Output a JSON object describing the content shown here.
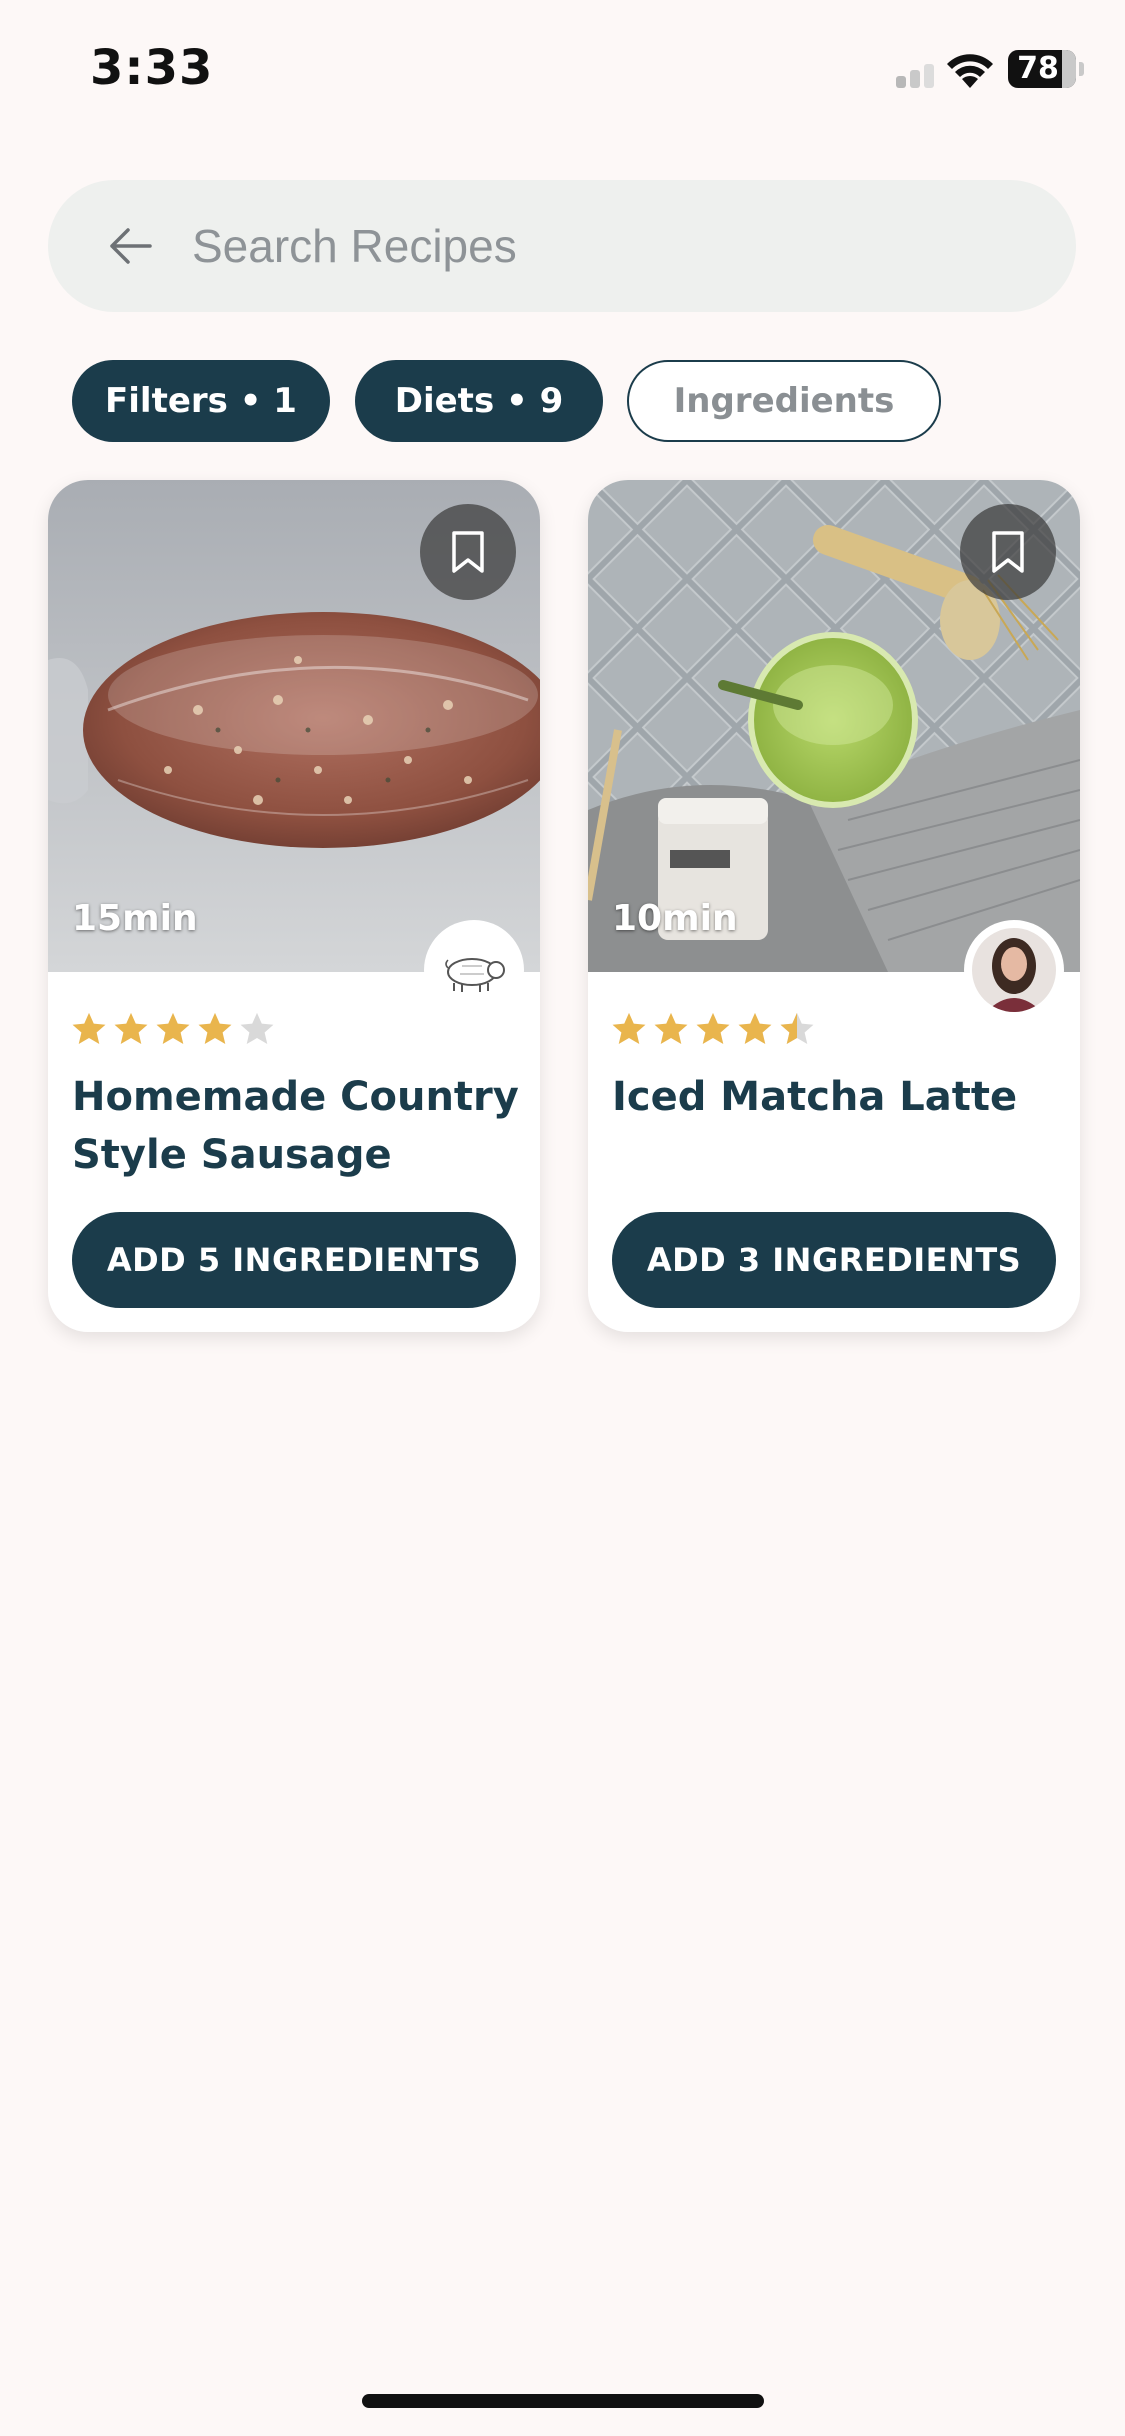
{
  "status_bar": {
    "time": "3:33",
    "battery": "78"
  },
  "search": {
    "placeholder": "Search Recipes"
  },
  "chips": [
    {
      "label": "Filters • 1",
      "active": true
    },
    {
      "label": "Diets • 9",
      "active": true
    },
    {
      "label": "Ingredients",
      "active": false
    }
  ],
  "recipes": [
    {
      "time": "15min",
      "rating": 4,
      "title": "Homemade Country Style Sausage",
      "button": "ADD 5 INGREDIENTS",
      "author_avatar": "pig-drawing-avatar"
    },
    {
      "time": "10min",
      "rating": 4.5,
      "title": "Iced Matcha Latte",
      "button": "ADD 3 INGREDIENTS",
      "author_avatar": "woman-portrait-avatar"
    }
  ],
  "colors": {
    "primary": "#1b3c4b",
    "star": "#e9b54d",
    "star_empty": "#d9d9d9",
    "background": "#fdf8f7"
  }
}
